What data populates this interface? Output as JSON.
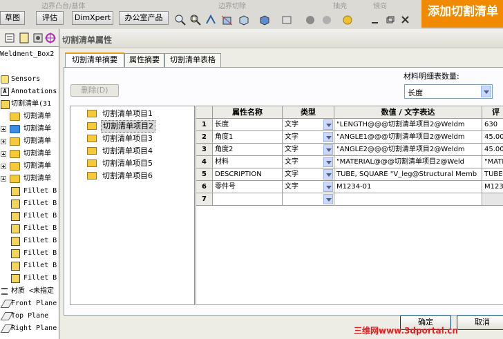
{
  "toolbar_top": {
    "faded_items": [
      "边界凸台/基体",
      "边界切除",
      "抽壳",
      "镜向"
    ]
  },
  "command_tabs": [
    "草图",
    "评估",
    "DimXpert",
    "办公室产品"
  ],
  "brand_banner": "添加切割清单",
  "tree_toolbar": {
    "icons": [
      "feature-manager-icon",
      "property-manager-icon",
      "configuration-manager-icon",
      "dimxpert-manager-icon"
    ]
  },
  "feature_tree": {
    "part_name": "Weldment_Box2",
    "sensors": "Sensors",
    "annotations": "Annotations",
    "cut_list_root": "切割清单(31",
    "cut_list_items": [
      "切割清单",
      "切割清单",
      "切割清单",
      "切割清单",
      "切割清单",
      "切割清单"
    ],
    "fillet_bodies": [
      "Fillet B",
      "Fillet B",
      "Fillet B",
      "Fillet B",
      "Fillet B",
      "Fillet B",
      "Fillet B",
      "Fillet B"
    ],
    "material": "材质 <未指定",
    "planes": [
      "Front Plane",
      "Top Plane",
      "Right Plane"
    ]
  },
  "dialog": {
    "title": "切割清单属性",
    "tabs": [
      "切割清单摘要",
      "属性摘要",
      "切割清单表格"
    ],
    "delete_button": "删除(D)",
    "material_label": "材料明细表数量:",
    "material_select": "长度",
    "list_items": [
      "切割清单项目1",
      "切割清单项目2",
      "切割清单项目3",
      "切割清单项目4",
      "切割清单项目5",
      "切割清单项目6"
    ],
    "selected_list_index": 1,
    "table": {
      "headers": [
        "属性名称",
        "类型",
        "数值 / 文字表达",
        "评"
      ],
      "rows": [
        {
          "num": "1",
          "name": "长度",
          "type": "文字",
          "expr": "\"LENGTH@@@切割清单项目2@Weldm",
          "eval": "630"
        },
        {
          "num": "2",
          "name": "角度1",
          "type": "文字",
          "expr": "\"ANGLE1@@@切割清单项目2@Weldm",
          "eval": "45.00"
        },
        {
          "num": "3",
          "name": "角度2",
          "type": "文字",
          "expr": "\"ANGLE2@@@切割清单项目2@Weldm",
          "eval": "45.00"
        },
        {
          "num": "4",
          "name": "材料",
          "type": "文字",
          "expr": "\"MATERIAL@@@切割清单项目2@Weld",
          "eval": "\"MATE"
        },
        {
          "num": "5",
          "name": "DESCRIPTION",
          "type": "文字",
          "expr": "TUBE, SQUARE \"V_leg@Structural Memb",
          "eval": "TUBE,"
        },
        {
          "num": "6",
          "name": "零件号",
          "type": "文字",
          "expr": "M1234-01",
          "eval": "M1234"
        },
        {
          "num": "7",
          "name": "",
          "type": "",
          "expr": "",
          "eval": ""
        }
      ]
    },
    "ok_button": "确定",
    "cancel_button": "取消"
  },
  "watermark": "三维网www.3dportal.cn",
  "colors": {
    "brand": "#f28a00",
    "tab_highlight": "#e89c1a",
    "selection": "#d8d8d8",
    "watermark": "#e02020"
  }
}
